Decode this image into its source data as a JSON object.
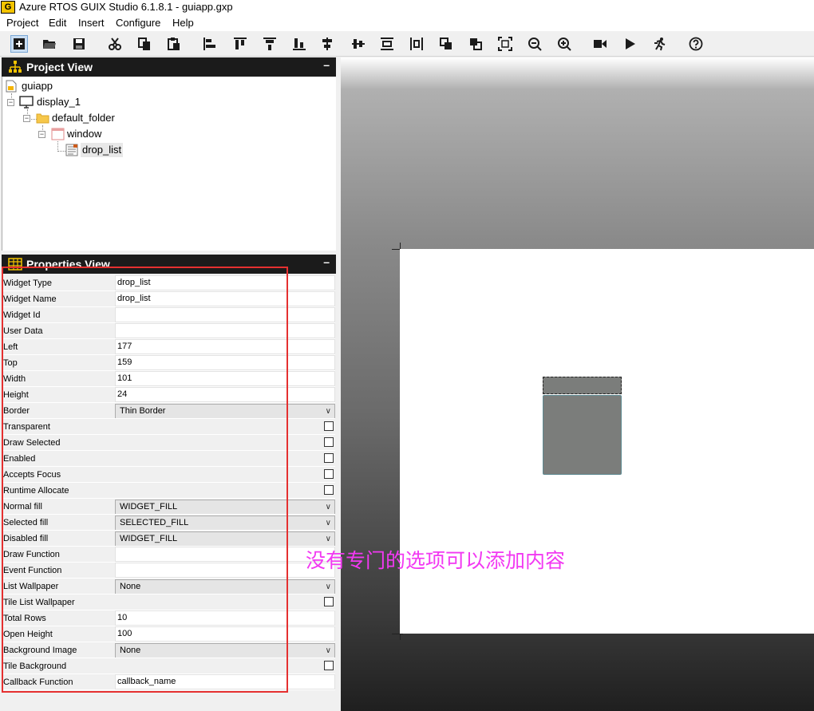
{
  "window": {
    "title": "Azure RTOS GUIX Studio 6.1.8.1 - guiapp.gxp",
    "app_icon_text": "G"
  },
  "menu": [
    "Project",
    "Edit",
    "Insert",
    "Configure",
    "Help"
  ],
  "toolbar": {
    "icons": [
      "add-icon",
      "open-folder-icon",
      "save-icon",
      "cut-icon",
      "copy-icon",
      "paste-icon",
      "align-left-icon",
      "align-top-icon",
      "align-bottom-icon",
      "align-center-horizontal-icon",
      "center-horizontal-icon",
      "center-vertical-icon",
      "align-middle-icon",
      "bring-to-front-icon",
      "send-to-back-icon",
      "fit-screen-icon",
      "zoom-out-icon",
      "zoom-in-icon",
      "record-macro-icon",
      "run-icon",
      "playback-icon",
      "help-icon"
    ]
  },
  "project_view": {
    "title": "Project View",
    "minimize": "–",
    "tree": [
      {
        "label": "guiapp",
        "icon": "project-icon"
      },
      {
        "label": "display_1",
        "icon": "display-icon"
      },
      {
        "label": "default_folder",
        "icon": "folder-icon"
      },
      {
        "label": "window",
        "icon": "window-icon"
      },
      {
        "label": "drop_list",
        "icon": "drop-list-icon"
      }
    ]
  },
  "properties_view": {
    "title": "Properties View",
    "minimize": "–",
    "rows": [
      {
        "label": "Widget Type",
        "kind": "text",
        "value": "drop_list"
      },
      {
        "label": "Widget Name",
        "kind": "text",
        "value": "drop_list"
      },
      {
        "label": "Widget Id",
        "kind": "text",
        "value": ""
      },
      {
        "label": "User Data",
        "kind": "text",
        "value": ""
      },
      {
        "label": "Left",
        "kind": "text",
        "value": "177"
      },
      {
        "label": "Top",
        "kind": "text",
        "value": "159"
      },
      {
        "label": "Width",
        "kind": "text",
        "value": "101"
      },
      {
        "label": "Height",
        "kind": "text",
        "value": "24"
      },
      {
        "label": "Border",
        "kind": "combo",
        "value": "Thin Border"
      },
      {
        "label": "Transparent",
        "kind": "check",
        "value": ""
      },
      {
        "label": "Draw Selected",
        "kind": "check",
        "value": ""
      },
      {
        "label": "Enabled",
        "kind": "check",
        "value": ""
      },
      {
        "label": "Accepts Focus",
        "kind": "check",
        "value": ""
      },
      {
        "label": "Runtime Allocate",
        "kind": "check",
        "value": ""
      },
      {
        "label": "Normal fill",
        "kind": "combo",
        "value": "WIDGET_FILL"
      },
      {
        "label": "Selected fill",
        "kind": "combo",
        "value": "SELECTED_FILL"
      },
      {
        "label": "Disabled fill",
        "kind": "combo",
        "value": "WIDGET_FILL"
      },
      {
        "label": "Draw Function",
        "kind": "text",
        "value": ""
      },
      {
        "label": "Event Function",
        "kind": "text",
        "value": ""
      },
      {
        "label": "List Wallpaper",
        "kind": "combo",
        "value": "None"
      },
      {
        "label": "Tile List Wallpaper",
        "kind": "check",
        "value": ""
      },
      {
        "label": "Total Rows",
        "kind": "text",
        "value": "10"
      },
      {
        "label": "Open Height",
        "kind": "text",
        "value": "100"
      },
      {
        "label": "Background Image",
        "kind": "combo",
        "value": "None"
      },
      {
        "label": "Tile Background",
        "kind": "check",
        "value": ""
      },
      {
        "label": "Callback Function",
        "kind": "text",
        "value": "callback_name"
      }
    ]
  },
  "annotation": {
    "text": "没有专门的选项可以添加内容",
    "color": "#f238f2",
    "box_color": "#e53030"
  }
}
